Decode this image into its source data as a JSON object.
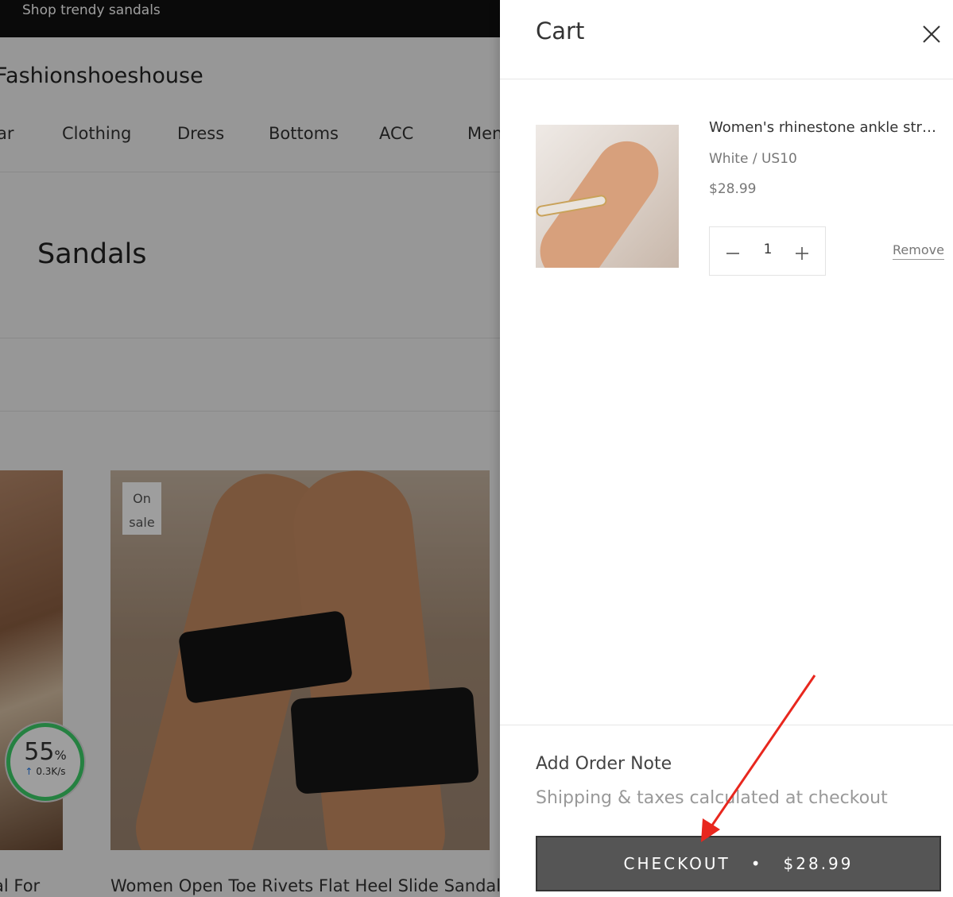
{
  "store": {
    "announcement": "Shop trendy sandals",
    "logo_text": "Fashionshoeshouse",
    "nav_items": [
      "ar",
      "Clothing",
      "Dress",
      "Bottoms",
      "ACC",
      "Men"
    ],
    "collection_title": "Sandals",
    "products": [
      {
        "title": "al For"
      },
      {
        "title": "Women Open Toe Rivets Flat Heel Slide Sandals",
        "badge": "On sale"
      }
    ]
  },
  "speed_widget": {
    "percent": "55",
    "percent_sign": "%",
    "rate": "0.3K/s",
    "ring_color": "#3dd16a"
  },
  "cart": {
    "title": "Cart",
    "items": [
      {
        "title": "Women's rhinestone ankle strap...",
        "variant": "White / US10",
        "price": "$28.99",
        "quantity": "1",
        "remove_label": "Remove"
      }
    ],
    "order_note_label": "Add Order Note",
    "shipping_note": "Shipping & taxes calculated at checkout",
    "checkout_label": "CHECKOUT",
    "checkout_separator": "•",
    "checkout_total": "$28.99"
  },
  "colors": {
    "checkout_bg": "#555555",
    "annotation_arrow": "#e8271e"
  }
}
